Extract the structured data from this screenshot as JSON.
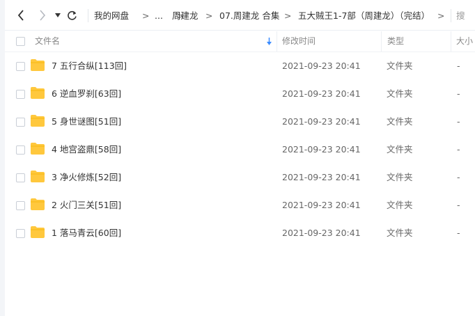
{
  "nav": {
    "back_icon": "chevron-left-icon",
    "forward_icon": "chevron-right-icon",
    "dropdown_icon": "triangle-down-icon",
    "refresh_icon": "refresh-icon"
  },
  "breadcrumb": {
    "items": [
      "我的网盘",
      "...",
      "周建龙",
      "07.周建龙 合集",
      "五大贼王1-7部（周建龙）（完结）"
    ],
    "separator": ">",
    "trailing_separator": ">"
  },
  "search": {
    "label": "搜"
  },
  "columns": {
    "name": "文件名",
    "modified": "修改时间",
    "type": "类型",
    "size": "大小",
    "sort_icon": "sort-down-arrow-icon",
    "sort_color": "#3b8cff"
  },
  "folder_color": "#ffc83d",
  "files": [
    {
      "name": "7 五行合纵[113回]",
      "modified": "2021-09-23 20:41",
      "type": "文件夹",
      "size": "-"
    },
    {
      "name": "6 逆血罗刹[63回]",
      "modified": "2021-09-23 20:41",
      "type": "文件夹",
      "size": "-"
    },
    {
      "name": "5 身世谜图[51回]",
      "modified": "2021-09-23 20:41",
      "type": "文件夹",
      "size": "-"
    },
    {
      "name": "4 地宫盗鼎[58回]",
      "modified": "2021-09-23 20:41",
      "type": "文件夹",
      "size": "-"
    },
    {
      "name": "3 净火修炼[52回]",
      "modified": "2021-09-23 20:41",
      "type": "文件夹",
      "size": "-"
    },
    {
      "name": "2 火门三关[51回]",
      "modified": "2021-09-23 20:41",
      "type": "文件夹",
      "size": "-"
    },
    {
      "name": "1 落马青云[60回]",
      "modified": "2021-09-23 20:41",
      "type": "文件夹",
      "size": "-"
    }
  ]
}
